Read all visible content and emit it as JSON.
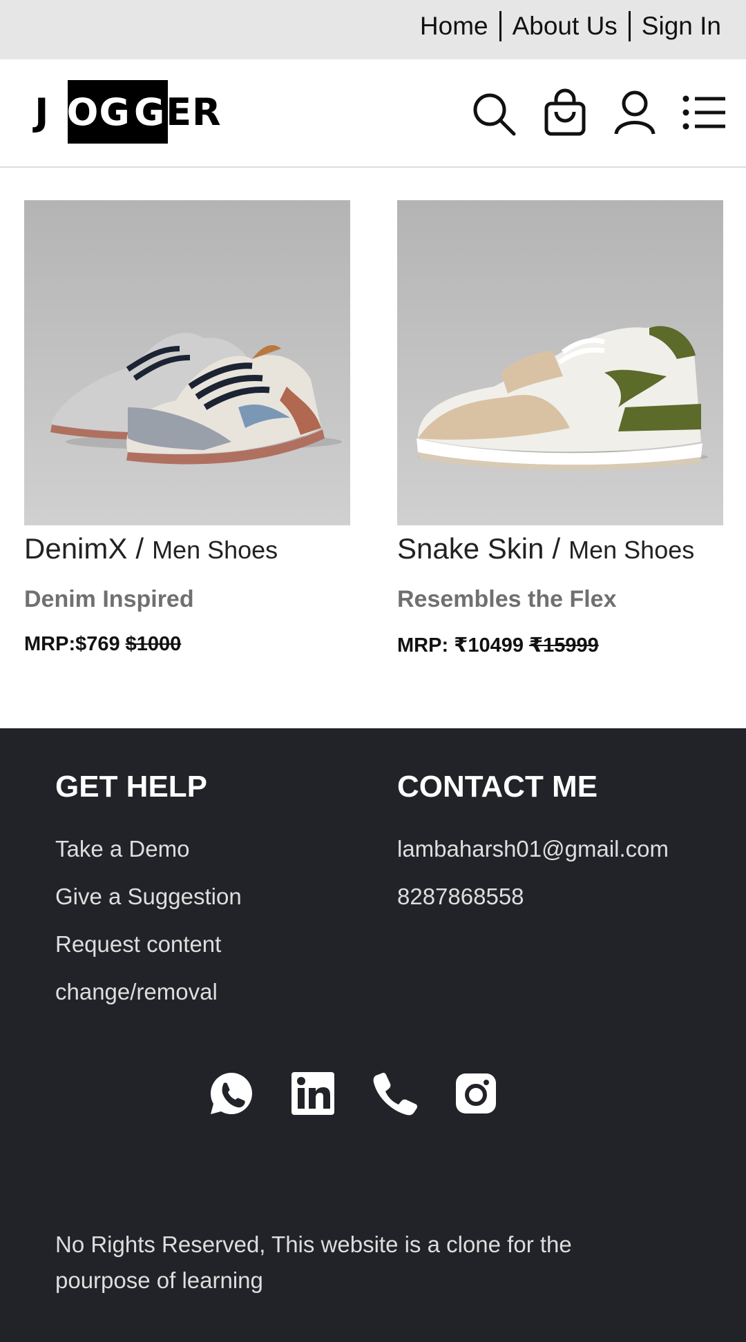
{
  "topbar": {
    "links": [
      "Home",
      "About Us",
      "Sign In"
    ]
  },
  "header": {
    "logo_letters": [
      "J",
      "O",
      "G",
      "G",
      "E",
      "R"
    ],
    "icons": [
      "search-icon",
      "shopping-bag-icon",
      "user-icon",
      "menu-list-icon"
    ]
  },
  "products": [
    {
      "name": "DenimX",
      "category": "Men Shoes",
      "subtitle": "Denim Inspired",
      "price": "MRP:$769",
      "old_price": "$1000",
      "image": "grey denim low-top sneakers"
    },
    {
      "name": "Snake Skin",
      "category": "Men Shoes",
      "subtitle": "Resembles the Flex",
      "price": "MRP: ₹10499",
      "old_price": "₹15999",
      "image": "olive and tan snakeskin sneaker"
    }
  ],
  "footer": {
    "help": {
      "title": "GET HELP",
      "links": [
        "Take a Demo",
        "Give a Suggestion",
        "Request content",
        "change/removal"
      ]
    },
    "contact": {
      "title": "CONTACT ME",
      "email": "lambaharsh01@gmail.com",
      "phone": "8287868558"
    },
    "socials": [
      "whatsapp-icon",
      "linkedin-icon",
      "phone-icon",
      "instagram-icon"
    ],
    "rights": "No Rights Reserved, This website is a clone for the pourpose of learning"
  },
  "colors": {
    "topbar_bg": "#e6e6e6",
    "footer_bg": "#212328",
    "subtitle_grey": "#707070",
    "product_bg": "#bdbdbd"
  }
}
